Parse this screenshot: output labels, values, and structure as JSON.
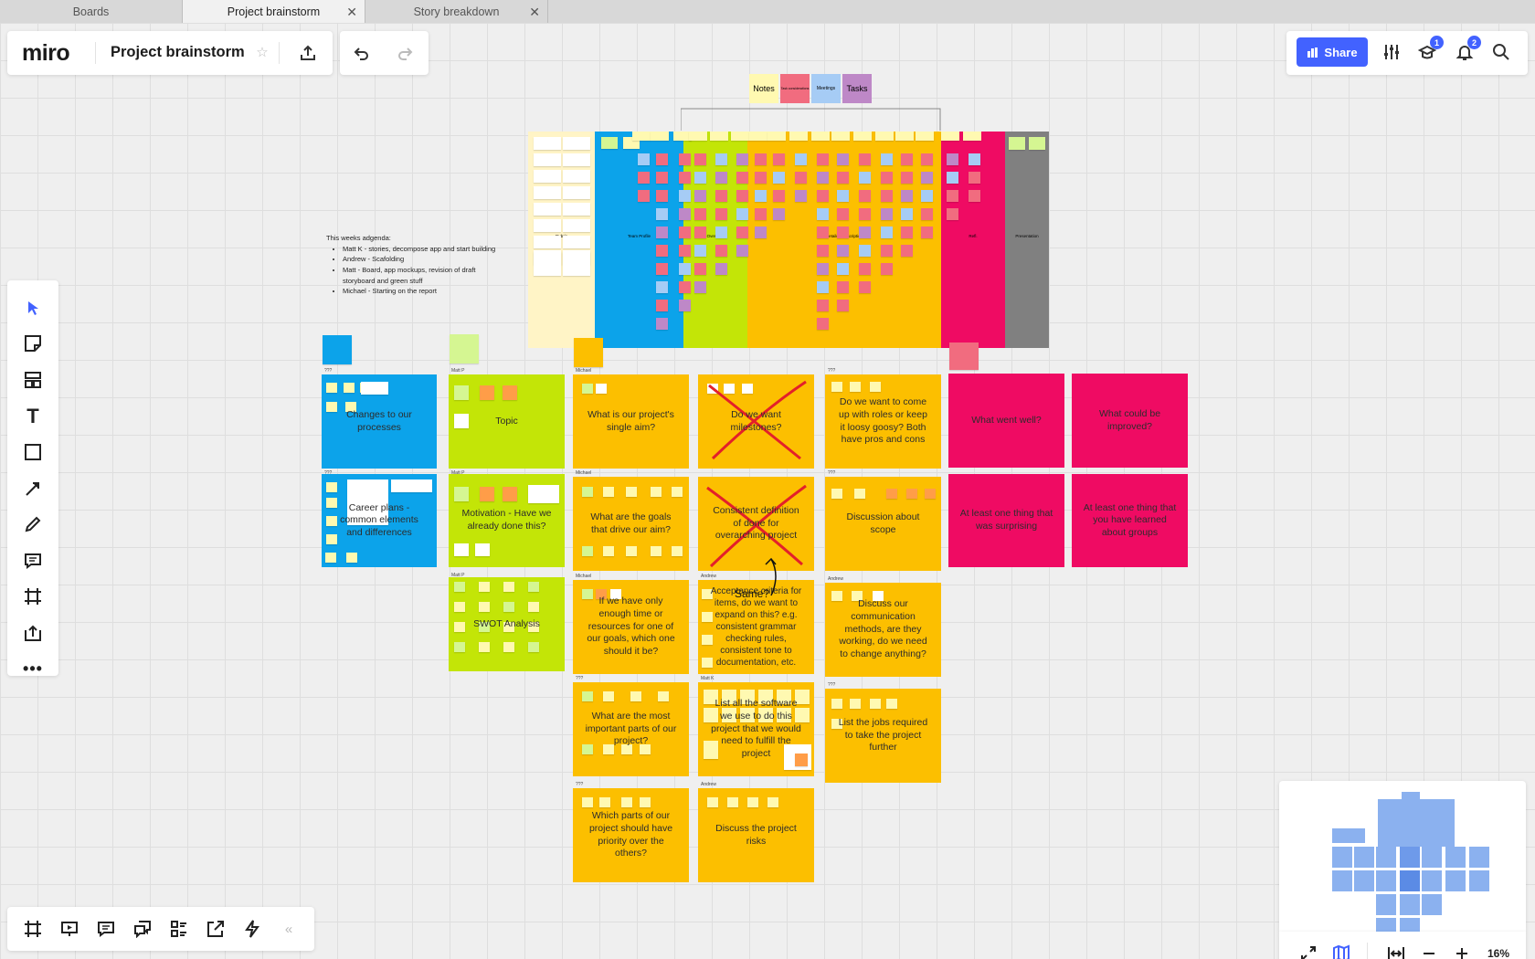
{
  "tabs": [
    {
      "label": "Boards",
      "active": false,
      "closable": false
    },
    {
      "label": "Project brainstorm",
      "active": true,
      "closable": true
    },
    {
      "label": "Story breakdown",
      "active": false,
      "closable": true
    }
  ],
  "header": {
    "logo": "miro",
    "board_title": "Project brainstorm",
    "share_label": "Share",
    "education_badge": "1",
    "notifications_badge": "2"
  },
  "legend": {
    "items": [
      {
        "label": "Notes",
        "color": "#fff9b1"
      },
      {
        "label": "Task considerations",
        "color": "#f16c7f"
      },
      {
        "label": "Meetings",
        "color": "#a6ccf5"
      },
      {
        "label": "Tasks",
        "color": "#be88c7"
      }
    ]
  },
  "report_columns": [
    {
      "label": "Rubric",
      "color": "#fff4c6"
    },
    {
      "label": "Team Profile",
      "color": "#0ca3ea"
    },
    {
      "label": "Overview",
      "color": "#c3e507"
    },
    {
      "label": "Detailed Description",
      "color": "#fcbf00"
    },
    {
      "label": "Refl.",
      "color": "#ef0b63"
    },
    {
      "label": "Presentation",
      "color": "#808080"
    }
  ],
  "agenda": {
    "title": "This weeks adgenda:",
    "items": [
      "Matt K - stories, decompose app and start building",
      "Andrew - Scafolding",
      "Matt - Board, app mockups, revision of draft storyboard and green stuff",
      "Michael - Starting on the report"
    ]
  },
  "frames": {
    "changes": {
      "owner": "???",
      "label": "Changes to our processes"
    },
    "career": {
      "owner": "???",
      "label": "Career plans - common elements and differences"
    },
    "topic": {
      "owner": "Matt P",
      "label": "Topic"
    },
    "motivation": {
      "owner": "Matt P",
      "label": "Motivation - Have we already done this?"
    },
    "swot": {
      "owner": "Matt P",
      "label": "SWOT Analysis"
    },
    "aim": {
      "owner": "Michael",
      "label": "What is our project's single aim?"
    },
    "goals": {
      "owner": "Michael",
      "label": "What are the goals that drive our aim?"
    },
    "time": {
      "owner": "Michael",
      "label": "If we have only enough time or resources for one of our goals, which one should it be?"
    },
    "important": {
      "owner": "???",
      "label": "What are the most important parts of our project?"
    },
    "priority": {
      "owner": "???",
      "label": "Which parts of our project should have priority over the others?"
    },
    "milestones": {
      "owner": "",
      "label": "Do we want milestones?"
    },
    "done": {
      "owner": "",
      "label": "Consistent definition of done for overarching project"
    },
    "same_note": "Same?",
    "acceptance": {
      "owner": "Andrew",
      "label": "Acceptance criteria for items, do we want to expand on this? e.g. consistent grammar checking rules, consistent tone to documentation, etc."
    },
    "software": {
      "owner": "Matt K",
      "label": "List all the software we use to do this project that we would need to fulfill the project"
    },
    "risks": {
      "owner": "Andrew",
      "label": "Discuss the project risks"
    },
    "roles": {
      "owner": "???",
      "label": "Do we want to come up with roles or keep it loosy goosy? Both have pros and cons"
    },
    "scope": {
      "owner": "???",
      "label": "Discussion about scope"
    },
    "communication": {
      "owner": "Andrew",
      "label": "Discuss our communication methods, are they working, do we need to change anything?"
    },
    "jobs": {
      "owner": "???",
      "label": "List the jobs required to take the project further"
    },
    "went_well": {
      "label": "What went well?"
    },
    "improved": {
      "label": "What could be improved?"
    },
    "surprising": {
      "label": "At least one thing that was surprising"
    },
    "learned": {
      "label": "At least one thing that you have learned about groups"
    }
  },
  "zoom": {
    "level": "16%"
  },
  "colors": {
    "blue_frame": "#0ca3ea",
    "green_frame": "#c3e507",
    "orange_frame": "#fcbf00",
    "pink_frame": "#ef0b63",
    "accent": "#4262ff",
    "cross": "#e3202a"
  }
}
